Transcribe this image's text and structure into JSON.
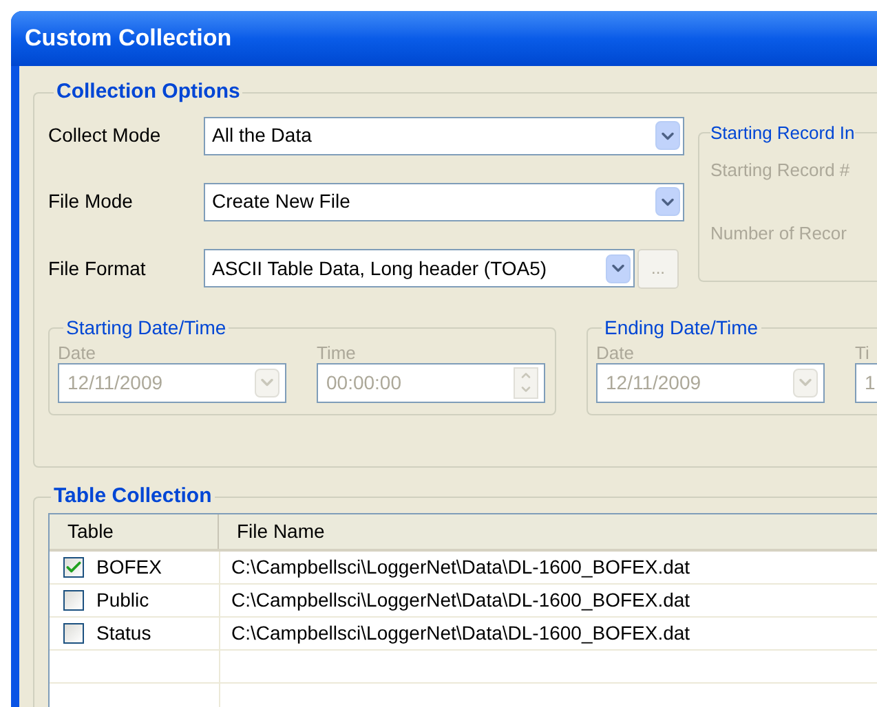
{
  "window": {
    "title": "Custom Collection"
  },
  "collection_options": {
    "title": "Collection Options",
    "fields": [
      {
        "label": "Collect Mode",
        "value": "All the Data"
      },
      {
        "label": "File Mode",
        "value": "Create New File"
      },
      {
        "label": "File Format",
        "value": "ASCII Table Data, Long header (TOA5)",
        "browse_button": "..."
      }
    ],
    "starting_record": {
      "title": "Starting Record In",
      "labels": [
        "Starting Record #",
        "Number of Recor"
      ],
      "disabled": true
    },
    "starting_datetime": {
      "title": "Starting Date/Time",
      "date_label": "Date",
      "date": "12/11/2009",
      "time_label": "Time",
      "time": "00:00:00",
      "disabled": true
    },
    "ending_datetime": {
      "title": "Ending Date/Time",
      "date_label": "Date",
      "date": "12/11/2009",
      "time_label": "Ti",
      "time": "1",
      "disabled": true
    }
  },
  "table_collection": {
    "title": "Table Collection",
    "columns": [
      "Table",
      "File Name"
    ],
    "rows": [
      {
        "table": "BOFEX",
        "file_name": "C:\\Campbellsci\\LoggerNet\\Data\\DL-1600_BOFEX.dat",
        "checked": true
      },
      {
        "table": "Public",
        "file_name": "C:\\Campbellsci\\LoggerNet\\Data\\DL-1600_BOFEX.dat",
        "checked": false
      },
      {
        "table": "Status",
        "file_name": "C:\\Campbellsci\\LoggerNet\\Data\\DL-1600_BOFEX.dat",
        "checked": false
      }
    ]
  }
}
